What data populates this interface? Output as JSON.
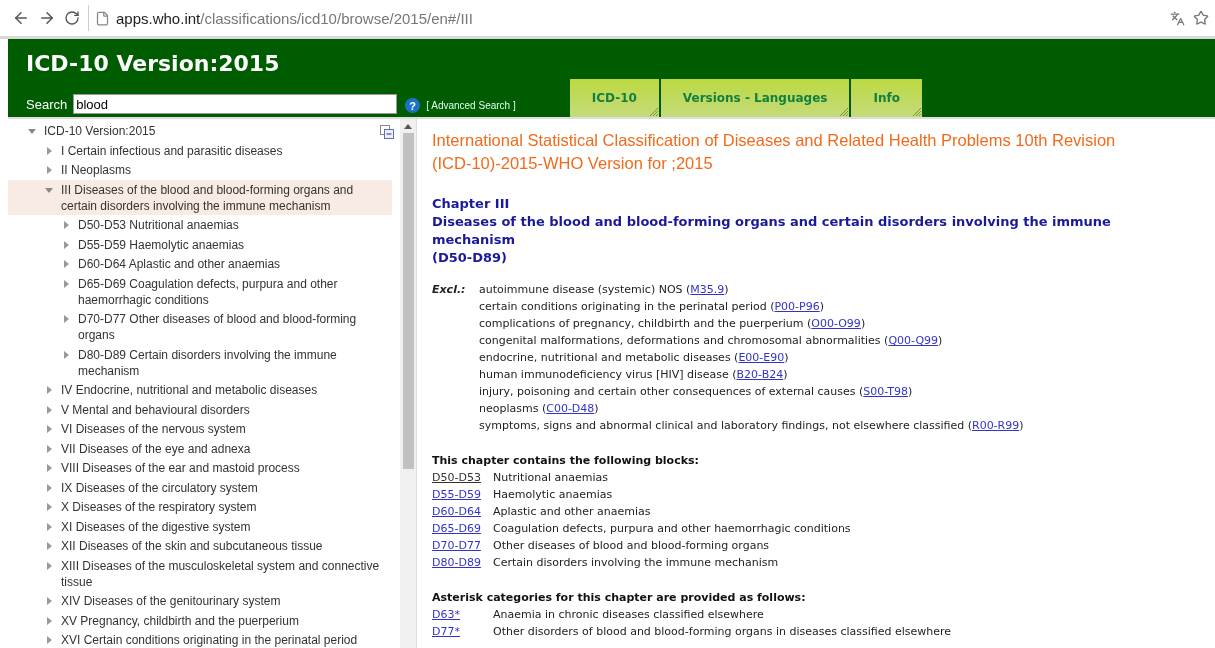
{
  "browser": {
    "url_host": "apps.who.int",
    "url_path": "/classifications/icd10/browse/2015/en#/III"
  },
  "header": {
    "title": "ICD-10 Version:2015",
    "search": {
      "label": "Search",
      "value": "blood"
    },
    "help": "?",
    "advanced_search": "[ Advanced Search ]",
    "tabs": [
      {
        "label": "ICD-10"
      },
      {
        "label": "Versions - Languages"
      },
      {
        "label": "Info"
      }
    ]
  },
  "tree": {
    "label": "ICD-10 Version:2015",
    "expanded": true,
    "selected": false,
    "children": [
      {
        "label": "I Certain infectious and parasitic diseases",
        "expanded": false,
        "selected": false
      },
      {
        "label": "II Neoplasms",
        "expanded": false,
        "selected": false
      },
      {
        "label": "III Diseases of the blood and blood-forming organs and certain disorders involving the immune mechanism",
        "expanded": true,
        "selected": true,
        "children": [
          {
            "label": "D50-D53 Nutritional anaemias",
            "expanded": false,
            "selected": false
          },
          {
            "label": "D55-D59 Haemolytic anaemias",
            "expanded": false,
            "selected": false
          },
          {
            "label": "D60-D64 Aplastic and other anaemias",
            "expanded": false,
            "selected": false
          },
          {
            "label": "D65-D69 Coagulation defects, purpura and other haemorrhagic conditions",
            "expanded": false,
            "selected": false
          },
          {
            "label": "D70-D77 Other diseases of blood and blood-forming organs",
            "expanded": false,
            "selected": false
          },
          {
            "label": "D80-D89 Certain disorders involving the immune mechanism",
            "expanded": false,
            "selected": false
          }
        ]
      },
      {
        "label": "IV Endocrine, nutritional and metabolic diseases",
        "expanded": false,
        "selected": false
      },
      {
        "label": "V Mental and behavioural disorders",
        "expanded": false,
        "selected": false
      },
      {
        "label": "VI Diseases of the nervous system",
        "expanded": false,
        "selected": false
      },
      {
        "label": "VII Diseases of the eye and adnexa",
        "expanded": false,
        "selected": false
      },
      {
        "label": "VIII Diseases of the ear and mastoid process",
        "expanded": false,
        "selected": false
      },
      {
        "label": "IX Diseases of the circulatory system",
        "expanded": false,
        "selected": false
      },
      {
        "label": "X Diseases of the respiratory system",
        "expanded": false,
        "selected": false
      },
      {
        "label": "XI Diseases of the digestive system",
        "expanded": false,
        "selected": false
      },
      {
        "label": "XII Diseases of the skin and subcutaneous tissue",
        "expanded": false,
        "selected": false
      },
      {
        "label": "XIII Diseases of the musculoskeletal system and connective tissue",
        "expanded": false,
        "selected": false
      },
      {
        "label": "XIV Diseases of the genitourinary system",
        "expanded": false,
        "selected": false
      },
      {
        "label": "XV Pregnancy, childbirth and the puerperium",
        "expanded": false,
        "selected": false
      },
      {
        "label": "XVI Certain conditions originating in the perinatal period",
        "expanded": false,
        "selected": false
      }
    ]
  },
  "content": {
    "title_lines": [
      "International Statistical Classification of Diseases and Related Health Problems 10th Revision",
      "(ICD-10)-2015-WHO Version for ;2015"
    ],
    "chapter": {
      "number": "Chapter III",
      "title": "Diseases of the blood and blood-forming organs and certain disorders involving the immune mechanism",
      "range": "(D50-D89)"
    },
    "exclusions": {
      "label": "Excl.:",
      "items": [
        {
          "before": "autoimmune disease (systemic) NOS (",
          "code": "M35.9",
          "after": ")"
        },
        {
          "before": "certain conditions originating in the perinatal period (",
          "code": "P00-P96",
          "after": ")"
        },
        {
          "before": "complications of pregnancy, childbirth and the puerperium (",
          "code": "O00-O99",
          "after": ")"
        },
        {
          "before": "congenital malformations, deformations and chromosomal abnormalities (",
          "code": "Q00-Q99",
          "after": ")"
        },
        {
          "before": "endocrine, nutritional and metabolic diseases (",
          "code": "E00-E90",
          "after": ")"
        },
        {
          "before": "human immunodeficiency virus [HIV] disease (",
          "code": "B20-B24",
          "after": ")"
        },
        {
          "before": "injury, poisoning and certain other consequences of external causes (",
          "code": "S00-T98",
          "after": ")"
        },
        {
          "before": "neoplasms (",
          "code": "C00-D48",
          "after": ")"
        },
        {
          "before": "symptoms, signs and abnormal clinical and laboratory findings, not elsewhere classified (",
          "code": "R00-R99",
          "after": ")"
        }
      ]
    },
    "blocks": {
      "heading": "This chapter contains the following blocks:",
      "items": [
        {
          "code": "D50-D53",
          "title": "Nutritional anaemias",
          "visited": true
        },
        {
          "code": "D55-D59",
          "title": "Haemolytic anaemias",
          "visited": false
        },
        {
          "code": "D60-D64",
          "title": "Aplastic and other anaemias",
          "visited": false
        },
        {
          "code": "D65-D69",
          "title": "Coagulation defects, purpura and other haemorrhagic conditions",
          "visited": false
        },
        {
          "code": "D70-D77",
          "title": "Other diseases of blood and blood-forming organs",
          "visited": false
        },
        {
          "code": "D80-D89",
          "title": "Certain disorders involving the immune mechanism",
          "visited": false
        }
      ]
    },
    "asterisk": {
      "heading": "Asterisk categories for this chapter are provided as follows:",
      "items": [
        {
          "code": "D63*",
          "title": "Anaemia in chronic diseases classified elsewhere",
          "visited": false
        },
        {
          "code": "D77*",
          "title": "Other disorders of blood and blood-forming organs in diseases classified elsewhere",
          "visited": false
        }
      ]
    }
  }
}
